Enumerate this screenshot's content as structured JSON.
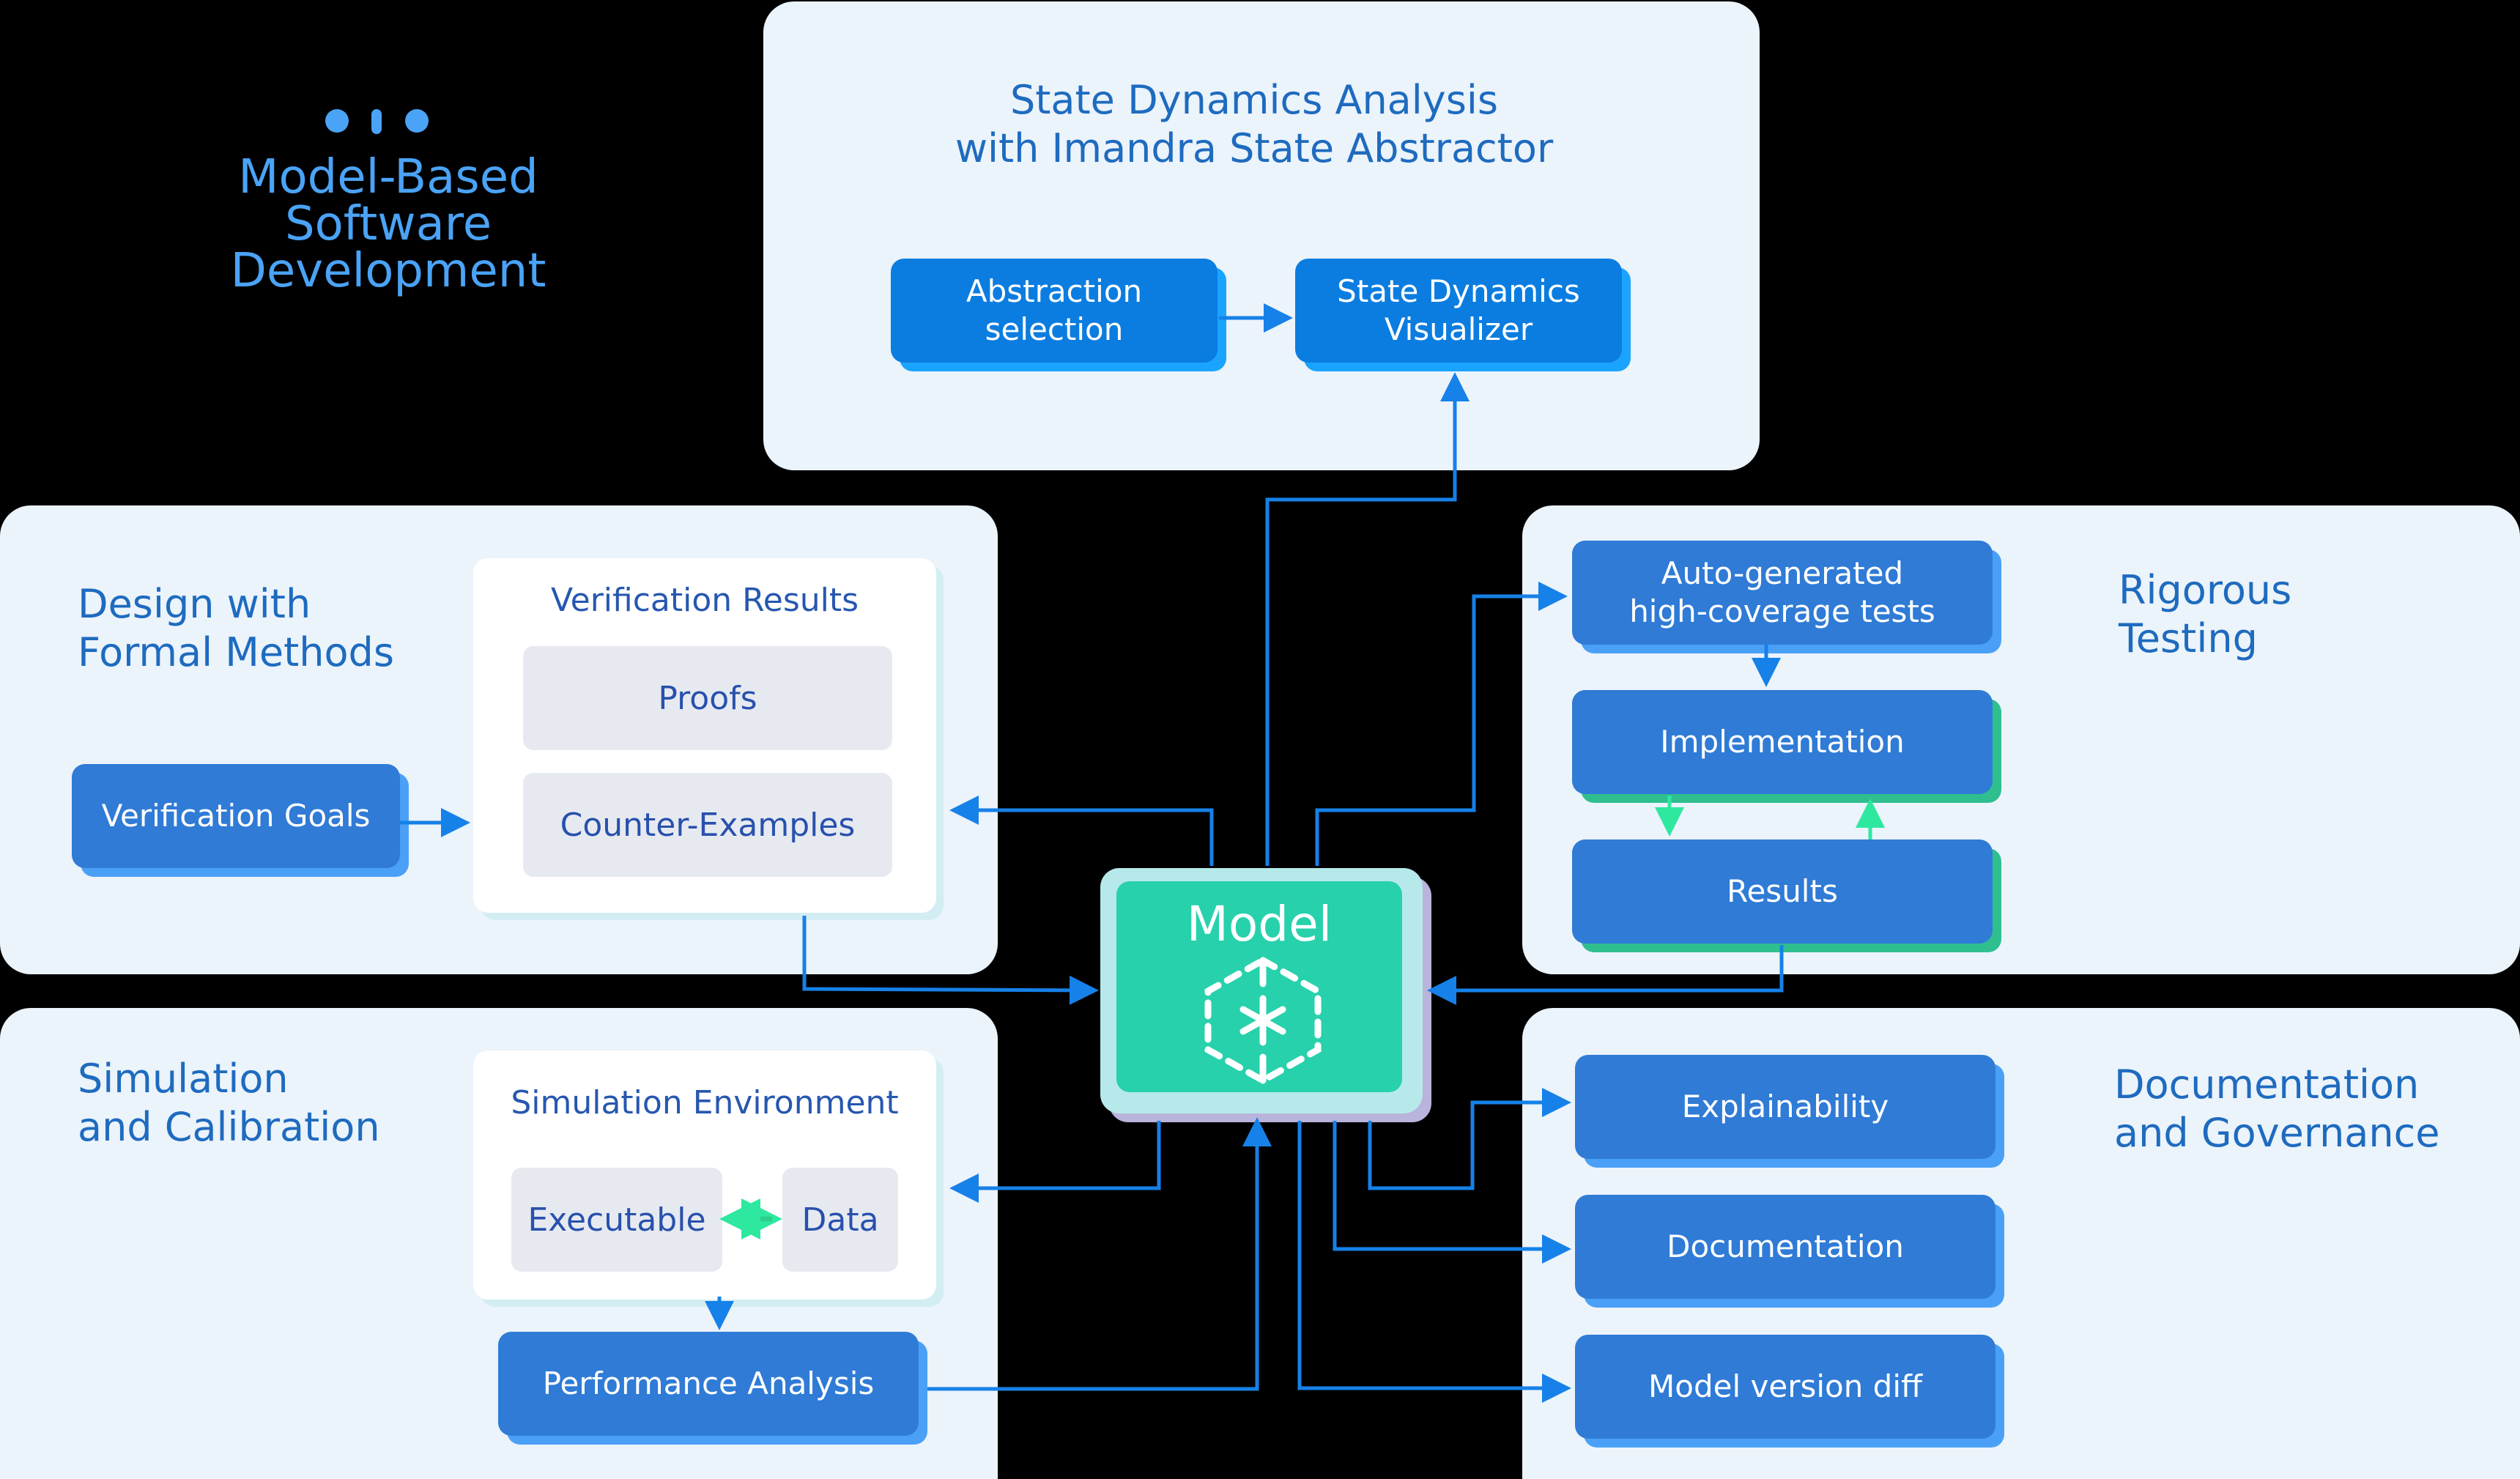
{
  "logo": {
    "icon": "three-dots-logo-icon",
    "title": "Model-Based\nSoftware\nDevelopment",
    "color": "#4aa3f6"
  },
  "colors": {
    "background": "#000000",
    "panel": "#ebf3fb",
    "section_title": "#1e6bbf",
    "node": "#2f7bd6",
    "node_bright": "#0b7de0",
    "model": "#27d1ac",
    "connector": "#1681e8",
    "feedback_connector": "#2ee8a0"
  },
  "sections": {
    "state_dynamics": {
      "title": "State Dynamics Analysis\nwith Imandra State Abstractor",
      "nodes": [
        "Abstraction\nselection",
        "State Dynamics\nVisualizer"
      ]
    },
    "formal_methods": {
      "title": "Design with\nFormal Methods",
      "goal_node": "Verification Goals",
      "results_card": {
        "title": "Verification Results",
        "items": [
          "Proofs",
          "Counter-Examples"
        ]
      }
    },
    "testing": {
      "title": "Rigorous\nTesting",
      "nodes": [
        "Auto-generated\nhigh-coverage tests",
        "Implementation",
        "Results"
      ]
    },
    "simulation": {
      "title": "Simulation\nand Calibration",
      "env_card": {
        "title": "Simulation Environment",
        "items": [
          "Executable",
          "Data"
        ]
      },
      "analysis_node": "Performance Analysis"
    },
    "documentation": {
      "title": "Documentation\nand Governance",
      "nodes": [
        "Explainability",
        "Documentation",
        "Model version diff"
      ]
    }
  },
  "model": {
    "label": "Model",
    "icon": "cube-3d-axes-icon"
  }
}
